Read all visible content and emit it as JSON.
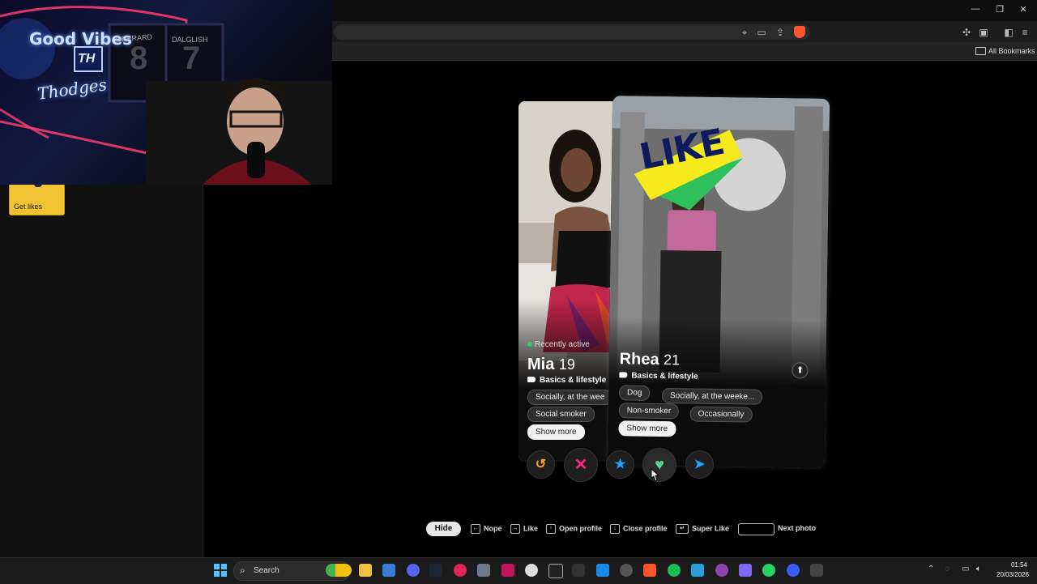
{
  "browser": {
    "bookmarks_label": "All Bookmarks"
  },
  "sidebar": {
    "get_likes_label": "Get likes"
  },
  "webcam": {
    "sign_line1": "Good Vibes",
    "sign_initials": "TH",
    "sign_line2": "Thodges",
    "jersey1": "GERRARD",
    "jersey1_num": "8",
    "jersey2": "DALGLISH",
    "jersey2_num": "7"
  },
  "cards": {
    "mia": {
      "status": "Recently active",
      "name": "Mia",
      "age": "19",
      "basics_label": "Basics & lifestyle",
      "chips": [
        "Socially, at the wee",
        "Social smoker"
      ],
      "show_more": "Show more"
    },
    "rhea": {
      "stamp": "LIKE",
      "name": "Rhea",
      "age": "21",
      "basics_label": "Basics & lifestyle",
      "chips": [
        "Dog",
        "Socially, at the weeke...",
        "Non-smoker",
        "Occasionally"
      ],
      "show_more": "Show more"
    }
  },
  "actions": {
    "rewind": "↺",
    "nope": "✕",
    "super_like": "★",
    "like": "♥",
    "boost": "➤"
  },
  "shortcuts": {
    "hide": "Hide",
    "nope": "Nope",
    "like": "Like",
    "open_profile": "Open profile",
    "close_profile": "Close profile",
    "super_like": "Super Like",
    "next_photo": "Next photo"
  },
  "taskbar": {
    "search_placeholder": "Search",
    "time": "01:54",
    "date": "20/03/2026"
  },
  "colors": {
    "like_green": "#58d68d",
    "nope_pink": "#fd267d",
    "super_blue": "#1ca3ff",
    "rewind_orange": "#f5a623",
    "gold": "#f1c232"
  }
}
